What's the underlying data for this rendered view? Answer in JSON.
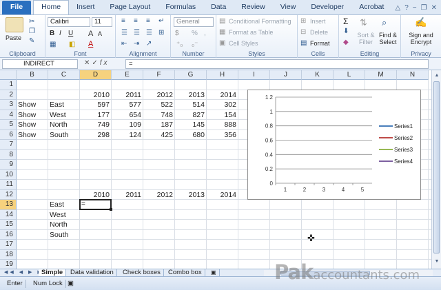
{
  "ribbon_tabs": [
    {
      "label": "File"
    },
    {
      "label": "Home"
    },
    {
      "label": "Insert"
    },
    {
      "label": "Page Layout"
    },
    {
      "label": "Formulas"
    },
    {
      "label": "Data"
    },
    {
      "label": "Review"
    },
    {
      "label": "View"
    },
    {
      "label": "Developer"
    },
    {
      "label": "Acrobat"
    }
  ],
  "ribbon": {
    "clipboard": {
      "label": "Clipboard",
      "paste": "Paste"
    },
    "font": {
      "label": "Font",
      "name": "Calibri",
      "size": "11",
      "bold": "B",
      "italic": "I",
      "underline": "U"
    },
    "alignment": {
      "label": "Alignment"
    },
    "number": {
      "label": "Number",
      "format": "General",
      "percent": "%",
      "comma": ","
    },
    "styles": {
      "label": "Styles",
      "conditional": "Conditional Formatting",
      "format_table": "Format as Table",
      "cell_styles": "Cell Styles"
    },
    "cells": {
      "label": "Cells",
      "insert": "Insert",
      "delete": "Delete",
      "format": "Format"
    },
    "editing": {
      "label": "Editing",
      "sort_filter": "Sort & Filter",
      "find_select": "Find & Select"
    },
    "privacy": {
      "label": "Privacy",
      "sign_encrypt": "Sign and Encrypt"
    }
  },
  "formula_bar": {
    "name_box": "INDIRECT",
    "formula": "="
  },
  "columns": [
    "B",
    "C",
    "D",
    "E",
    "F",
    "G",
    "H",
    "I",
    "J",
    "K",
    "L",
    "M",
    "N"
  ],
  "rows": [
    "1",
    "2",
    "3",
    "4",
    "5",
    "6",
    "7",
    "8",
    "9",
    "10",
    "11",
    "12",
    "13",
    "14",
    "15",
    "16",
    "17",
    "18",
    "19"
  ],
  "cells": {
    "years_top": [
      "2010",
      "2011",
      "2012",
      "2013",
      "2014"
    ],
    "table": [
      {
        "show": "Show",
        "region": "East",
        "v": [
          "597",
          "577",
          "522",
          "514",
          "302"
        ]
      },
      {
        "show": "Show",
        "region": "West",
        "v": [
          "177",
          "654",
          "748",
          "827",
          "154"
        ]
      },
      {
        "show": "Show",
        "region": "North",
        "v": [
          "749",
          "109",
          "187",
          "145",
          "888"
        ]
      },
      {
        "show": "Show",
        "region": "South",
        "v": [
          "298",
          "124",
          "425",
          "680",
          "356"
        ]
      }
    ],
    "years_bottom": [
      "2010",
      "2011",
      "2012",
      "2013",
      "2014"
    ],
    "regions_bottom": [
      "East",
      "West",
      "North",
      "South"
    ],
    "active_value": "="
  },
  "chart_data": {
    "type": "line",
    "x": [
      1,
      2,
      3,
      4,
      5
    ],
    "ylim": [
      0,
      1.2
    ],
    "yticks": [
      "0",
      "0.2",
      "0.4",
      "0.6",
      "0.8",
      "1",
      "1.2"
    ],
    "xticks": [
      "1",
      "2",
      "3",
      "4",
      "5"
    ],
    "grid": true,
    "legend": "right",
    "series": [
      {
        "name": "Series1",
        "color": "#4a7ebb",
        "values": []
      },
      {
        "name": "Series2",
        "color": "#be4b48",
        "values": []
      },
      {
        "name": "Series3",
        "color": "#98b954",
        "values": []
      },
      {
        "name": "Series4",
        "color": "#7d60a0",
        "values": []
      }
    ]
  },
  "sheet_tabs": [
    {
      "label": "Simple"
    },
    {
      "label": "Data validation"
    },
    {
      "label": "Check boxes"
    },
    {
      "label": "Combo box"
    }
  ],
  "status_bar": {
    "mode": "Enter",
    "num_lock": "Num Lock"
  },
  "watermark": {
    "brand": "Pak",
    "rest": "accountants.com"
  }
}
